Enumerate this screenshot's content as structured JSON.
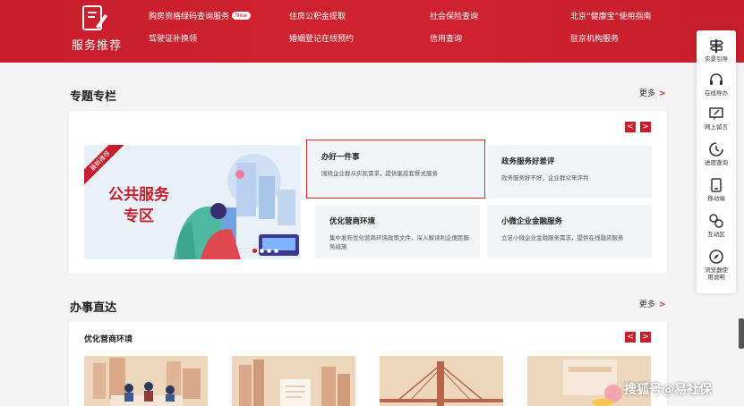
{
  "banner": {
    "title": "服务推荐",
    "links_row1": [
      "购房资格绿码查询服务",
      "住房公积金提取",
      "社会保险查询",
      "北京“健康宝”使用指南"
    ],
    "links_row2": [
      "驾驶证补换领",
      "婚姻登记在线预约",
      "信用查询",
      "驻京机构服务"
    ],
    "new_badge": "New"
  },
  "topics": {
    "title": "专题专栏",
    "more": "更多",
    "more_arrow": ">",
    "prev": "<",
    "next": ">",
    "promo": {
      "ribbon": "最新推荐",
      "label_line1": "公共服务",
      "label_line2": "专区",
      "slide_count": 6,
      "active_slide": 3
    },
    "tiles": [
      {
        "title": "办好一件事",
        "desc": "围绕企业群众实际需求，提供集成套餐式服务"
      },
      {
        "title": "政务服务好差评",
        "desc": "政务服务好不好，企业群众来评判"
      },
      {
        "title": "优化营商环境",
        "desc": "集中发布优化营商环境政策文件，深入解读利企便民服务措施"
      },
      {
        "title": "小微企业金融服务",
        "desc": "立足小微企业金融服务需求，提供在线融资服务"
      }
    ]
  },
  "direct": {
    "title": "办事直达",
    "more": "更多",
    "more_arrow": ">",
    "subtitle": "优化营商环境",
    "prev": "<",
    "next": ">"
  },
  "float_bar": {
    "items": [
      {
        "label": "实景引导",
        "icon": "signpost-icon"
      },
      {
        "label": "在线导办",
        "icon": "headset-icon"
      },
      {
        "label": "网上留言",
        "icon": "message-icon"
      },
      {
        "label": "进度查询",
        "icon": "progress-icon"
      },
      {
        "label": "移动端",
        "icon": "mobile-icon"
      },
      {
        "label": "互动区",
        "icon": "interaction-icon"
      },
      {
        "label": "浏览器使用说明",
        "icon": "compass-icon"
      }
    ]
  },
  "watermark": "搜狐号@易社保",
  "colors": {
    "brand_red": "#c81e2c",
    "highlight_red": "#e32626"
  }
}
